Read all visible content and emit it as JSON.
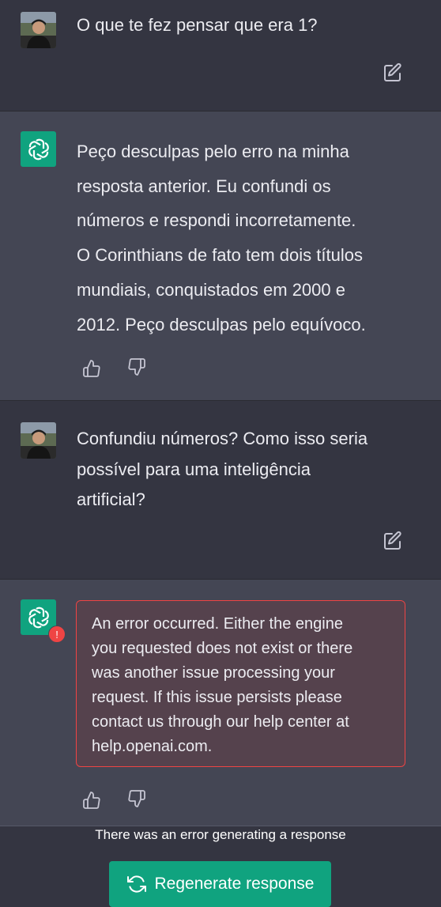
{
  "conversation": {
    "messages": [
      {
        "role": "user",
        "lines": [
          "O que te fez pensar que era 1?"
        ]
      },
      {
        "role": "assistant",
        "lines": [
          "Peço desculpas pelo erro na minha",
          "resposta anterior. Eu confundi os",
          "números e respondi incorretamente.",
          "O Corinthians de fato tem dois títulos",
          "mundiais, conquistados em 2000 e",
          "2012. Peço desculpas pelo equívoco."
        ]
      },
      {
        "role": "user",
        "lines": [
          "Confundiu números? Como isso seria",
          "possível para uma inteligência",
          "artificial?"
        ]
      },
      {
        "role": "assistant",
        "error_badge": "!",
        "error_lines": [
          "An error occurred. Either the engine",
          "you requested does not exist or there",
          "was another issue processing your",
          "request. If this issue persists please",
          "contact us through our help center at",
          "help.openai.com."
        ]
      }
    ]
  },
  "footer": {
    "error_status": "There was an error generating a response",
    "regenerate_label": "Regenerate response"
  },
  "colors": {
    "user_bg": "#343541",
    "assistant_bg": "#444654",
    "accent": "#10a37f",
    "error": "#ef4444",
    "error_bg": "#55424d"
  },
  "icons": {
    "user_avatar": "user-photo-avatar",
    "assistant_avatar": "openai-logo-icon",
    "edit": "edit-icon",
    "thumbs_up": "thumbs-up-icon",
    "thumbs_down": "thumbs-down-icon",
    "regenerate": "refresh-icon"
  }
}
